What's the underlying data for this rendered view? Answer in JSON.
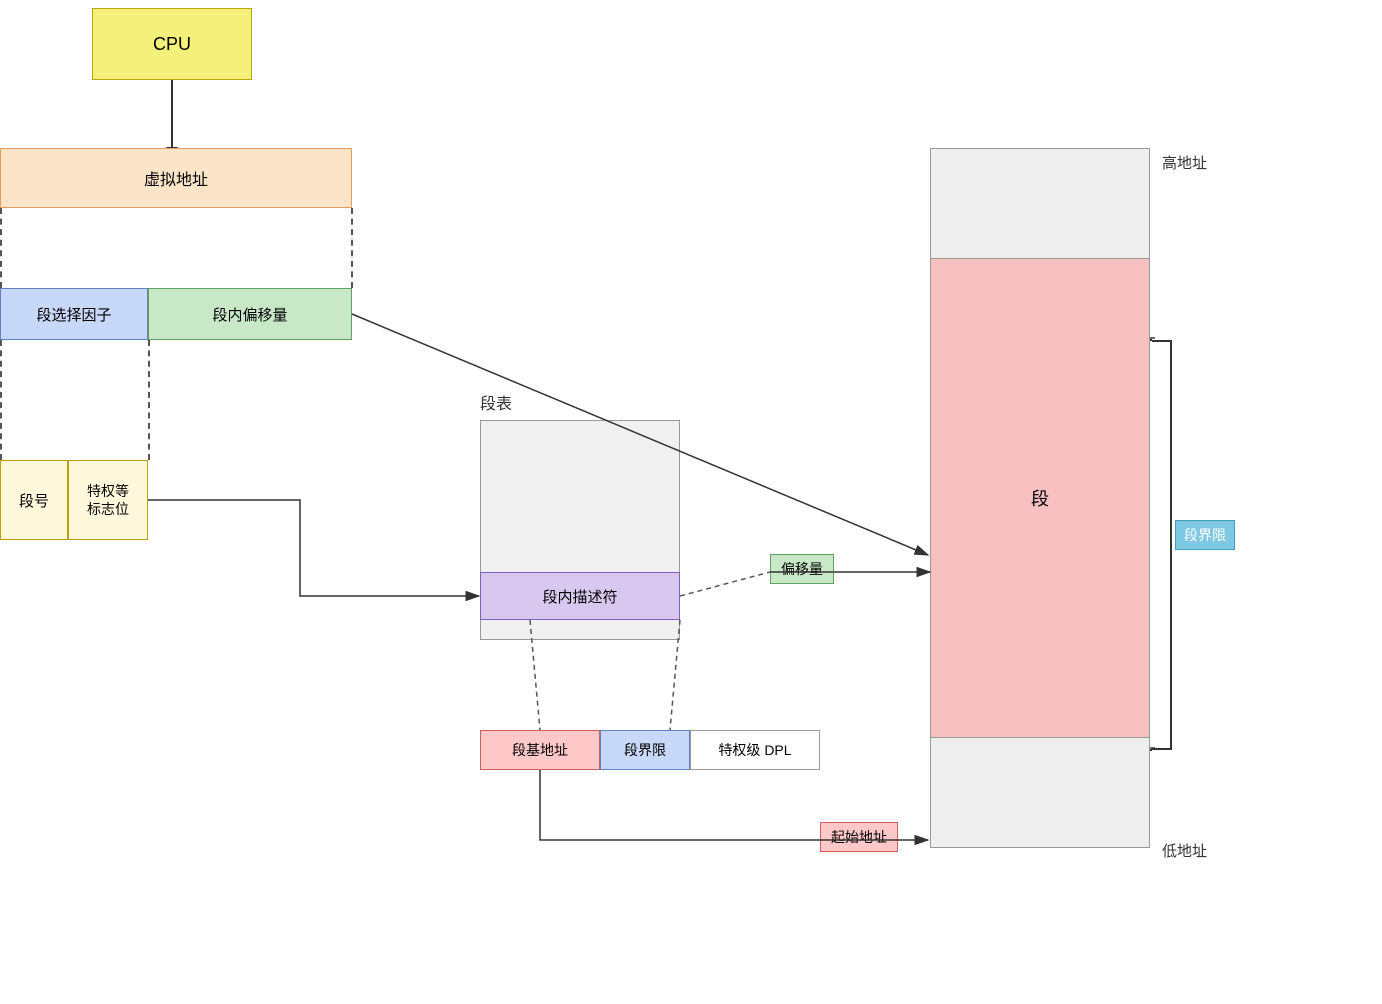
{
  "cpu": {
    "label": "CPU"
  },
  "virtual_addr": {
    "label": "虚拟地址"
  },
  "seg_selector": {
    "label": "段选择因子"
  },
  "seg_offset": {
    "label": "段内偏移量"
  },
  "seg_num": {
    "label": "段号"
  },
  "priv_flag": {
    "label": "特权等\n标志位"
  },
  "seg_table": {
    "label": "段表"
  },
  "seg_descriptor": {
    "label": "段内描述符"
  },
  "memory_segment": {
    "label": "段"
  },
  "high_addr": {
    "label": "高地址"
  },
  "low_addr": {
    "label": "低地址"
  },
  "seg_limit_right": {
    "label": "段界限"
  },
  "offset_badge": {
    "label": "偏移量"
  },
  "seg_base_addr": {
    "label": "段基地址"
  },
  "seg_limit_box": {
    "label": "段界限"
  },
  "dpl_box": {
    "label": "特权级 DPL"
  },
  "start_addr": {
    "label": "起始地址"
  }
}
